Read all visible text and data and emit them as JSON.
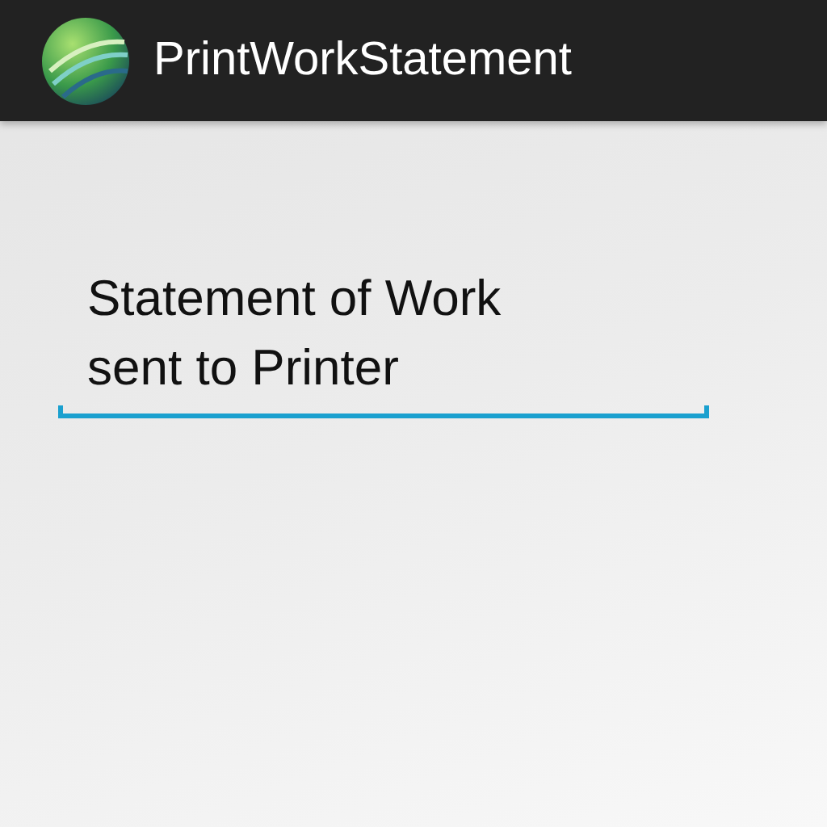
{
  "action_bar": {
    "title": "PrintWorkStatement"
  },
  "text_field": {
    "value": "Statement of Work\nsent to Printer"
  }
}
